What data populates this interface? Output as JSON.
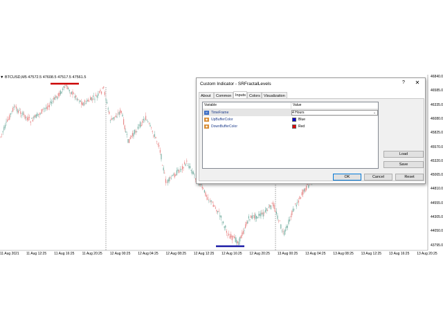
{
  "chart": {
    "title": "▼ BTCUSD,M5  47572.5 47608.5 47517.5 47561.5",
    "price_labels": [
      "46840.0",
      "46585.0",
      "46335.0",
      "46080.0",
      "45825.0",
      "45570.0",
      "45320.0",
      "45065.0",
      "44810.0",
      "44555.0",
      "44305.0",
      "44050.0",
      "43795.0"
    ],
    "time_labels": [
      "11 Aug 2021",
      "11 Aug 12:25",
      "11 Aug 16:25",
      "11 Aug 20:25",
      "12 Aug 00:25",
      "12 Aug 04:25",
      "12 Aug 08:25",
      "12 Aug 12:25",
      "12 Aug 16:25",
      "12 Aug 20:25",
      "13 Aug 00:25",
      "13 Aug 04:25",
      "13 Aug 08:25",
      "13 Aug 12:25",
      "13 Aug 16:25",
      "13 Aug 20:25"
    ],
    "colors": {
      "bull": "#7bb1a5",
      "bear": "#e88a8a",
      "up_level": "#cc0000",
      "down_level": "#1a1aa6",
      "separator": "#555555"
    }
  },
  "dialog": {
    "title": "Custom Indicator - SRFractalLevels",
    "help": "?",
    "close": "✕",
    "tabs": [
      "About",
      "Common",
      "Inputs",
      "Colors",
      "Visualization"
    ],
    "active_tab": "Inputs",
    "grid": {
      "headers": [
        "Variable",
        "Value"
      ],
      "rows": [
        {
          "icon": "timeframe-icon",
          "icon_text": "tf",
          "name": "TimeFrame",
          "value": "4 Hours"
        },
        {
          "icon": "color-icon",
          "icon_text": "◆",
          "name": "UpBufferColor",
          "value": "Blue",
          "swatch": "#0000cc"
        },
        {
          "icon": "color-icon",
          "icon_text": "◆",
          "name": "DownBufferColor",
          "value": "Red",
          "swatch": "#dd0000"
        }
      ]
    },
    "buttons": {
      "load": "Load",
      "save": "Save",
      "ok": "OK",
      "cancel": "Cancel",
      "reset": "Reset"
    }
  }
}
